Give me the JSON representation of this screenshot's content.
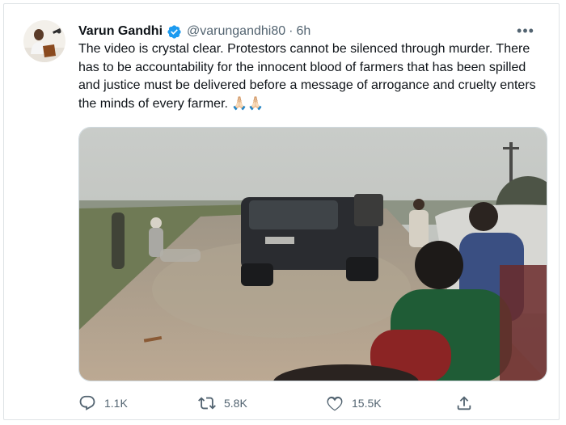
{
  "tweet": {
    "author": {
      "display_name": "Varun Gandhi",
      "handle": "@varungandhi80",
      "verified": true
    },
    "separator": "·",
    "time": "6h",
    "more_label": "•••",
    "text": "The video is crystal clear. Protestors cannot be silenced through murder. There has to be accountability for the innocent blood of farmers that has been spilled and justice must be delivered before a message of arrogance and cruelty enters the minds of every farmer. 🙏🏻🙏🏻",
    "metrics": {
      "replies": "1.1K",
      "retweets": "5.8K",
      "likes": "15.5K"
    }
  },
  "icons": {
    "verified": "verified-badge-icon",
    "reply": "reply-icon",
    "retweet": "retweet-icon",
    "like": "heart-icon",
    "share": "share-icon",
    "more": "more-icon"
  },
  "colors": {
    "text_primary": "#0f1419",
    "text_secondary": "#536471",
    "verified_blue": "#1d9bf0",
    "border": "#cfd9de"
  }
}
